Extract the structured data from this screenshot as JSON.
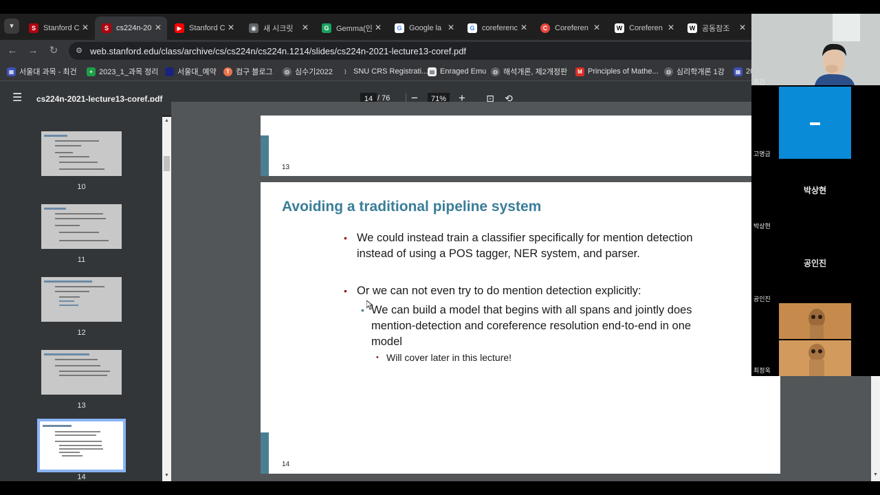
{
  "browser": {
    "tabs": [
      {
        "title": "Stanford C",
        "icon": "stanford-icon",
        "color": "#b1040e"
      },
      {
        "title": "cs224n-20",
        "icon": "stanford-icon",
        "color": "#b1040e"
      },
      {
        "title": "Stanford C",
        "icon": "youtube-icon",
        "color": "#ff0000"
      },
      {
        "title": "새 시크릿",
        "icon": "incognito-icon",
        "color": "#9aa0a6"
      },
      {
        "title": "Gemma(인",
        "icon": "gemma-icon",
        "color": "#1aa260"
      },
      {
        "title": "Google la",
        "icon": "google-icon",
        "color": "#4285f4"
      },
      {
        "title": "coreferenc",
        "icon": "google-icon",
        "color": "#4285f4"
      },
      {
        "title": "Coreferen",
        "icon": "coref-icon",
        "color": "#e8453c"
      },
      {
        "title": "Coreferen",
        "icon": "wikipedia-icon",
        "color": "#ffffff"
      },
      {
        "title": "공동참조",
        "icon": "wikipedia-icon",
        "color": "#ffffff"
      }
    ],
    "url": "web.stanford.edu/class/archive/cs/cs224n/cs224n.1214/slides/cs224n-2021-lecture13-coref.pdf",
    "bookmarks": [
      "서울대 과목 - 최건",
      "2023_1_과목 정리",
      "서울대_예약",
      "컴구 블로그",
      "심수기2022",
      "SNU CRS Registrati...",
      "Enraged Emu",
      "해석개론, 제2개정판",
      "Principles of Mathe...",
      "심리학개론 1강",
      "20"
    ]
  },
  "pdf": {
    "filename": "cs224n-2021-lecture13-coref.pdf",
    "current_page": "14",
    "total_pages": "/ 76",
    "zoom": "71%",
    "thumbnails": [
      "10",
      "11",
      "12",
      "13",
      "14"
    ],
    "prev_slide_number": "13",
    "slide": {
      "number": "14",
      "title": "Avoiding a traditional pipeline system",
      "bullet1": "We could instead train a classifier specifically for mention detection instead of using a POS tagger, NER system, and parser.",
      "bullet2": "Or we can not even try to do mention detection explicitly:",
      "sub_bullet": "We can build a model that begins with all spans and jointly does mention-detection and coreference resolution end-to-end in one model",
      "sub_sub_bullet": "Will cover later in this lecture!"
    }
  },
  "call": {
    "participants": [
      {
        "name": "최건"
      },
      {
        "name": "고명금"
      },
      {
        "name": "박상현"
      },
      {
        "name": "공인진"
      },
      {
        "name": "최정욱"
      }
    ],
    "tile_labels": [
      "박상현",
      "공인진"
    ]
  }
}
